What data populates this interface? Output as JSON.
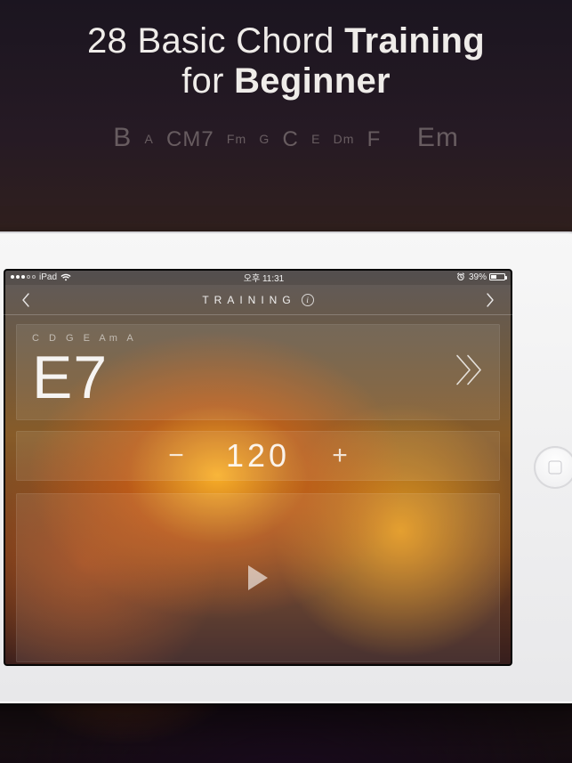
{
  "promo": {
    "headline_pre": "28 Basic Chord ",
    "headline_strong1": "Training",
    "headline_mid": "for ",
    "headline_strong2": "Beginner"
  },
  "chord_cloud": {
    "items": [
      "B",
      "A",
      "CM7",
      "Fm",
      "G",
      "C",
      "E",
      "Dm",
      "F",
      "Em"
    ]
  },
  "status": {
    "carrier": "iPad",
    "time": "오후 11:31",
    "battery_pct": "39%"
  },
  "nav": {
    "title": "TRAINING"
  },
  "chord": {
    "prev_sequence": "C  D  G  E  Am  A",
    "current": "E7"
  },
  "tempo": {
    "minus": "−",
    "plus": "+",
    "value": "120"
  }
}
